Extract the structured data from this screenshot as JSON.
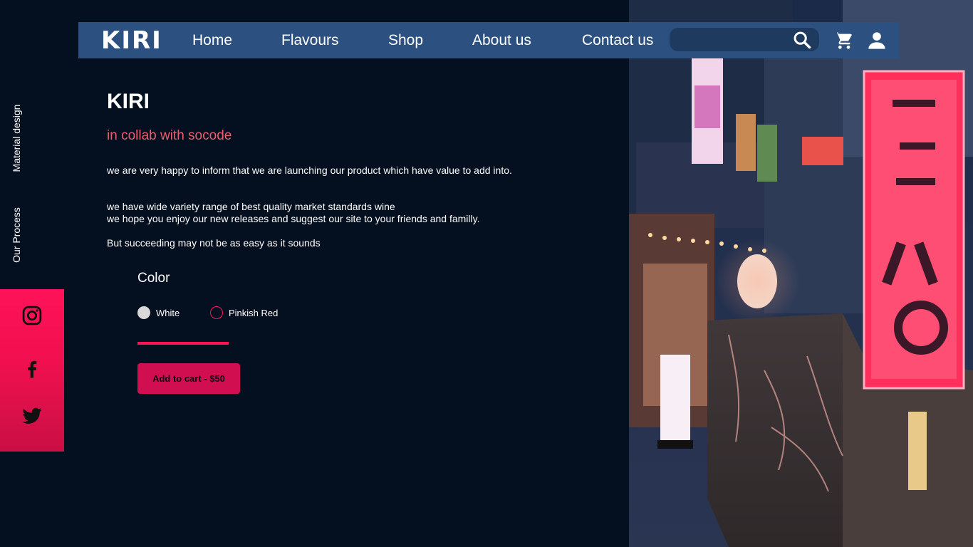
{
  "navbar": {
    "logo": "KIRI",
    "links": [
      "Home",
      "Flavours",
      "Shop",
      "About us",
      "Contact us"
    ],
    "search_placeholder": "",
    "icons": {
      "search": "search-icon",
      "cart": "cart-icon",
      "account": "user-icon"
    }
  },
  "side_links": [
    "Material design",
    "Our Process"
  ],
  "social": [
    "instagram-icon",
    "facebook-icon",
    "twitter-icon"
  ],
  "product": {
    "title": "KIRI",
    "subtitle": "in collab with socode",
    "paragraphs": [
      "we are very happy to inform that we are launching our product which have value to add into.",
      "we have wide variety range of best quality market standards wine\nwe hope you enjoy our new releases and suggest our site to your friends and familly.",
      "But succeeding may not be as easy as it sounds"
    ],
    "color_heading": "Color",
    "color_options": [
      {
        "label": "White",
        "color": "#d9d9d9",
        "selected": true
      },
      {
        "label": "Pinkish Red",
        "color": "#ff1258",
        "selected": false
      }
    ],
    "cart_button": "Add to cart - $50"
  },
  "colors": {
    "background": "#040f1f",
    "navbar": "#2c5180",
    "accent": "#ff1258",
    "subtitle": "#ea5f6e"
  }
}
